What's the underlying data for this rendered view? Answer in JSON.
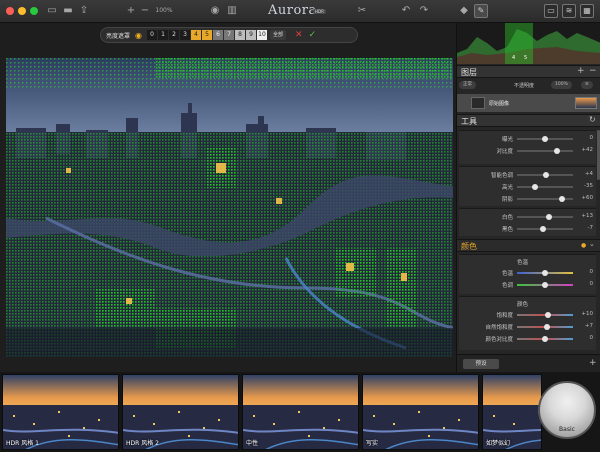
{
  "app": {
    "title": "Aurora",
    "badge": "HDR"
  },
  "toolbar": {
    "zoom": "100%"
  },
  "mask_bar": {
    "label": "亮度遮罩",
    "levels": [
      "0",
      "1",
      "2",
      "3",
      "4",
      "5",
      "6",
      "7",
      "8",
      "9",
      "10"
    ],
    "selected_levels": [
      "4",
      "5"
    ],
    "all_label": "全部"
  },
  "histogram": {
    "marker_left": "4",
    "marker_right": "5"
  },
  "layers": {
    "title": "图层",
    "blend_mode": "正常",
    "opacity_label": "不透明度",
    "opacity_value": "100%",
    "layer_name": "原始图像"
  },
  "tools": {
    "title": "工具",
    "sliders_a": [
      {
        "label": "曝光",
        "value": "0",
        "pos": 0.5
      },
      {
        "label": "对比度",
        "value": "+42",
        "pos": 0.71
      }
    ],
    "sliders_b": [
      {
        "label": "智能色调",
        "value": "+4",
        "pos": 0.52
      },
      {
        "label": "高光",
        "value": "-35",
        "pos": 0.33
      },
      {
        "label": "阴影",
        "value": "+60",
        "pos": 0.8
      }
    ],
    "sliders_c": [
      {
        "label": "白色",
        "value": "+13",
        "pos": 0.57
      },
      {
        "label": "黑色",
        "value": "-7",
        "pos": 0.47
      }
    ]
  },
  "color": {
    "title": "颜色",
    "temp_title": "色温",
    "temp_sliders": [
      {
        "label": "色温",
        "value": "0",
        "pos": 0.5
      },
      {
        "label": "色调",
        "value": "0",
        "pos": 0.5
      }
    ],
    "color_title": "颜色",
    "color_sliders": [
      {
        "label": "饱和度",
        "value": "+10",
        "pos": 0.55
      },
      {
        "label": "自然饱和度",
        "value": "+7",
        "pos": 0.53
      },
      {
        "label": "颜色对比度",
        "value": "0",
        "pos": 0.5
      }
    ]
  },
  "preset_tab": "预设",
  "presets": [
    {
      "label": "HDR 风格 1"
    },
    {
      "label": "HDR 风格 2"
    },
    {
      "label": "中性"
    },
    {
      "label": "写实"
    },
    {
      "label": "如梦似幻"
    }
  ],
  "basic_preset": "Basic",
  "colors": {
    "accent": "#e8a82a",
    "mask_green": "#1fd21f",
    "cancel": "#e04040",
    "confirm": "#55c040"
  }
}
